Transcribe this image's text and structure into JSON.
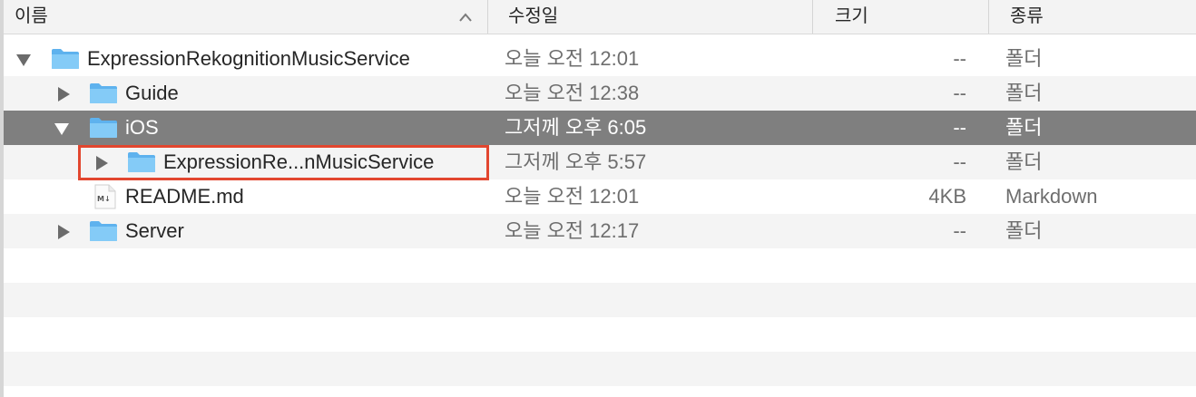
{
  "header": {
    "name_label": "이름",
    "date_label": "수정일",
    "size_label": "크기",
    "kind_label": "종류",
    "sort_icon": "chevron-up-icon"
  },
  "rows": [
    {
      "name": "ExpressionRekognitionMusicService",
      "date": "오늘 오전 12:01",
      "size": "--",
      "kind": "폴더",
      "icon": "folder-icon",
      "disclosure": "expanded"
    },
    {
      "name": "Guide",
      "date": "오늘 오전 12:38",
      "size": "--",
      "kind": "폴더",
      "icon": "folder-icon",
      "disclosure": "collapsed"
    },
    {
      "name": "iOS",
      "date": "그저께 오후 6:05",
      "size": "--",
      "kind": "폴더",
      "icon": "folder-icon",
      "disclosure": "expanded",
      "selected": true
    },
    {
      "name": "ExpressionRe...nMusicService",
      "date": "그저께 오후 5:57",
      "size": "--",
      "kind": "폴더",
      "icon": "folder-icon",
      "disclosure": "collapsed",
      "highlighted": true
    },
    {
      "name": "README.md",
      "date": "오늘 오전 12:01",
      "size": "4KB",
      "kind": "Markdown",
      "icon": "markdown-file-icon",
      "file_icon_label": "M↓"
    },
    {
      "name": "Server",
      "date": "오늘 오전 12:17",
      "size": "--",
      "kind": "폴더",
      "icon": "folder-icon",
      "disclosure": "collapsed"
    }
  ],
  "colors": {
    "selection": "#7f7f7f",
    "highlight_border": "#e2462f",
    "folder_blue": "#6fc1f5",
    "zebra": "#f4f4f4"
  }
}
